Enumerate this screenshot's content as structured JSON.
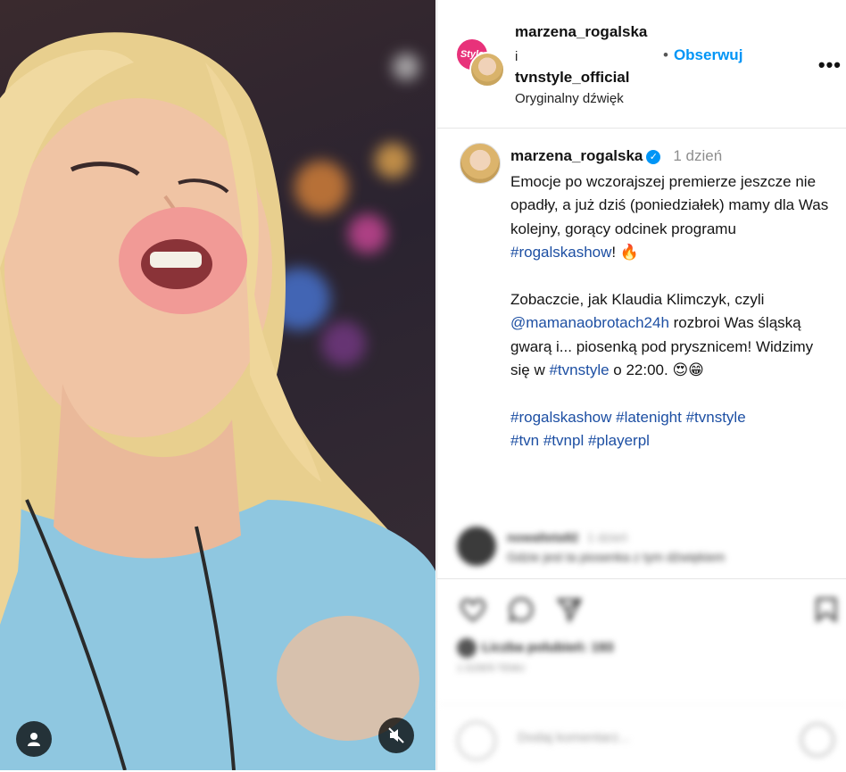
{
  "header": {
    "user1": "marzena_rogalska",
    "separator": "i",
    "user2": "tvnstyle_official",
    "follow_label": "Obserwuj",
    "follow_dot": "•",
    "audio_label": "Oryginalny dźwięk",
    "brand_avatar_text": "Style",
    "more": "•••"
  },
  "caption": {
    "username": "marzena_rogalska",
    "verified_mark": "✓",
    "time": "1 dzień",
    "para1_text": "Emocje po wczorajszej premierze jeszcze nie opadły, a już dziś (poniedziałek) mamy dla Was kolejny, gorący odcinek programu ",
    "para1_tag": "#rogalskashow",
    "para1_end": "! 🔥",
    "para2_a": "Zobaczcie, jak Klaudia Klimczyk, czyli ",
    "para2_mention": "@mamanaobrotach24h",
    "para2_b": " rozbroi Was śląską gwarą i... piosenką pod prysznicem! Widzimy się w ",
    "para2_tag": "#tvnstyle",
    "para2_c": " o 22:00. 😍😁",
    "hashtags_line1": "#rogalskashow #latenight #tvnstyle",
    "hashtags_line2": "#tvn #tvnpl #playerpl"
  },
  "comment": {
    "user": "nowalteta92",
    "time": "1 dzień",
    "text": "Gdzie jest ta piosenka z tym dźwiękiem"
  },
  "actions": {
    "likes": "Liczba polubień: 193",
    "ago": "1 DZIEŃ TEMU",
    "add_comment_placeholder": "Dodaj komentarz..."
  },
  "colors": {
    "link": "#0095f6",
    "tag": "#1d4fa3",
    "brand": "#e8327a"
  }
}
